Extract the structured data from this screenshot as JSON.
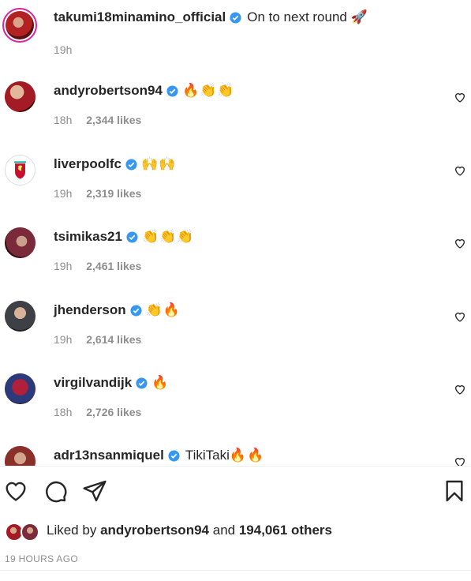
{
  "caption": {
    "username": "takumi18minamino_official",
    "text": "On to next round",
    "emoji": "🚀",
    "time": "19h"
  },
  "comments": [
    {
      "username": "andyrobertson94",
      "text": "",
      "emoji": "🔥👏👏",
      "time": "18h",
      "likes": "2,344 likes"
    },
    {
      "username": "liverpoolfc",
      "text": "",
      "emoji": "🙌🙌",
      "time": "19h",
      "likes": "2,319 likes"
    },
    {
      "username": "tsimikas21",
      "text": "",
      "emoji": "👏👏👏",
      "time": "19h",
      "likes": "2,461 likes"
    },
    {
      "username": "jhenderson",
      "text": "",
      "emoji": "👏🔥",
      "time": "19h",
      "likes": "2,614 likes"
    },
    {
      "username": "virgilvandijk",
      "text": "",
      "emoji": "🔥",
      "time": "18h",
      "likes": "2,726 likes"
    },
    {
      "username": "adr13nsanmiquel",
      "text": "TikiTaki",
      "emoji": "🔥🔥",
      "time": "",
      "likes": ""
    }
  ],
  "liked_by": {
    "prefix": "Liked by",
    "user": "andyrobertson94",
    "middle": "and",
    "count": "194,061 others"
  },
  "timestamp": "19 HOURS AGO",
  "colors": {
    "verified": "#3897f0",
    "muted": "#8e8e8e",
    "text": "#262626",
    "story_ring": "#d6249f"
  },
  "icons": {
    "like": "heart-icon",
    "comment": "comment-icon",
    "share": "paper-plane-icon",
    "save": "bookmark-icon"
  }
}
